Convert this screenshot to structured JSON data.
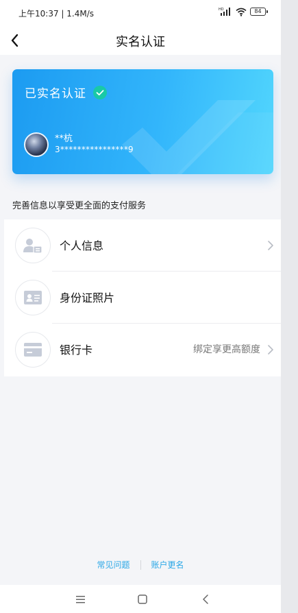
{
  "status_bar": {
    "time_speed": "上午10:37 | 1.4M/s",
    "signal_label": "HD",
    "battery": "84"
  },
  "nav": {
    "title": "实名认证"
  },
  "card": {
    "status": "已实名认证",
    "name": "**杭",
    "id_number": "3****************9"
  },
  "section": {
    "label": "完善信息以享受更全面的支付服务"
  },
  "rows": [
    {
      "label": "个人信息",
      "icon": "person-card-icon",
      "hint": "",
      "has_arrow": true
    },
    {
      "label": "身份证照片",
      "icon": "id-card-icon",
      "hint": "",
      "has_arrow": false
    },
    {
      "label": "银行卡",
      "icon": "bank-card-icon",
      "hint": "绑定享更高额度",
      "has_arrow": true
    }
  ],
  "footer": {
    "faq": "常见问题",
    "rename": "账户更名"
  },
  "colors": {
    "card_start": "#1c9bf1",
    "card_end": "#52d6fd",
    "link": "#2aa7e6",
    "check": "#19c9a6"
  }
}
